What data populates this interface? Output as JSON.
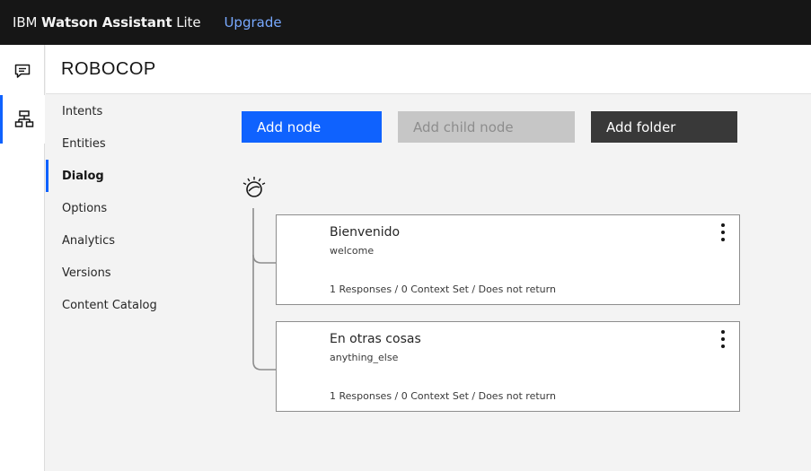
{
  "topbar": {
    "brand_prefix": "IBM ",
    "brand_product": "Watson Assistant",
    "brand_suffix": " Lite",
    "upgrade_label": "Upgrade"
  },
  "rail": {
    "items": [
      {
        "icon": "chat-icon",
        "active": false
      },
      {
        "icon": "skills-tree-icon",
        "active": true
      }
    ]
  },
  "header": {
    "title": "ROBOCOP"
  },
  "nav": {
    "items": [
      {
        "label": "Intents"
      },
      {
        "label": "Entities"
      },
      {
        "label": "Dialog",
        "active": true
      },
      {
        "label": "Options"
      },
      {
        "label": "Analytics"
      },
      {
        "label": "Versions"
      },
      {
        "label": "Content Catalog"
      }
    ]
  },
  "toolbar": {
    "add_node_label": "Add node",
    "add_child_node_label": "Add child node",
    "add_folder_label": "Add folder"
  },
  "nodes": [
    {
      "title": "Bienvenido",
      "condition": "welcome",
      "summary": "1 Responses / 0 Context Set / Does not return"
    },
    {
      "title": "En otras cosas",
      "condition": "anything_else",
      "summary": "1 Responses / 0 Context Set / Does not return"
    }
  ],
  "colors": {
    "accent": "#0f62fe",
    "topbar": "#161616",
    "upgrade_link": "#78a9ff"
  }
}
